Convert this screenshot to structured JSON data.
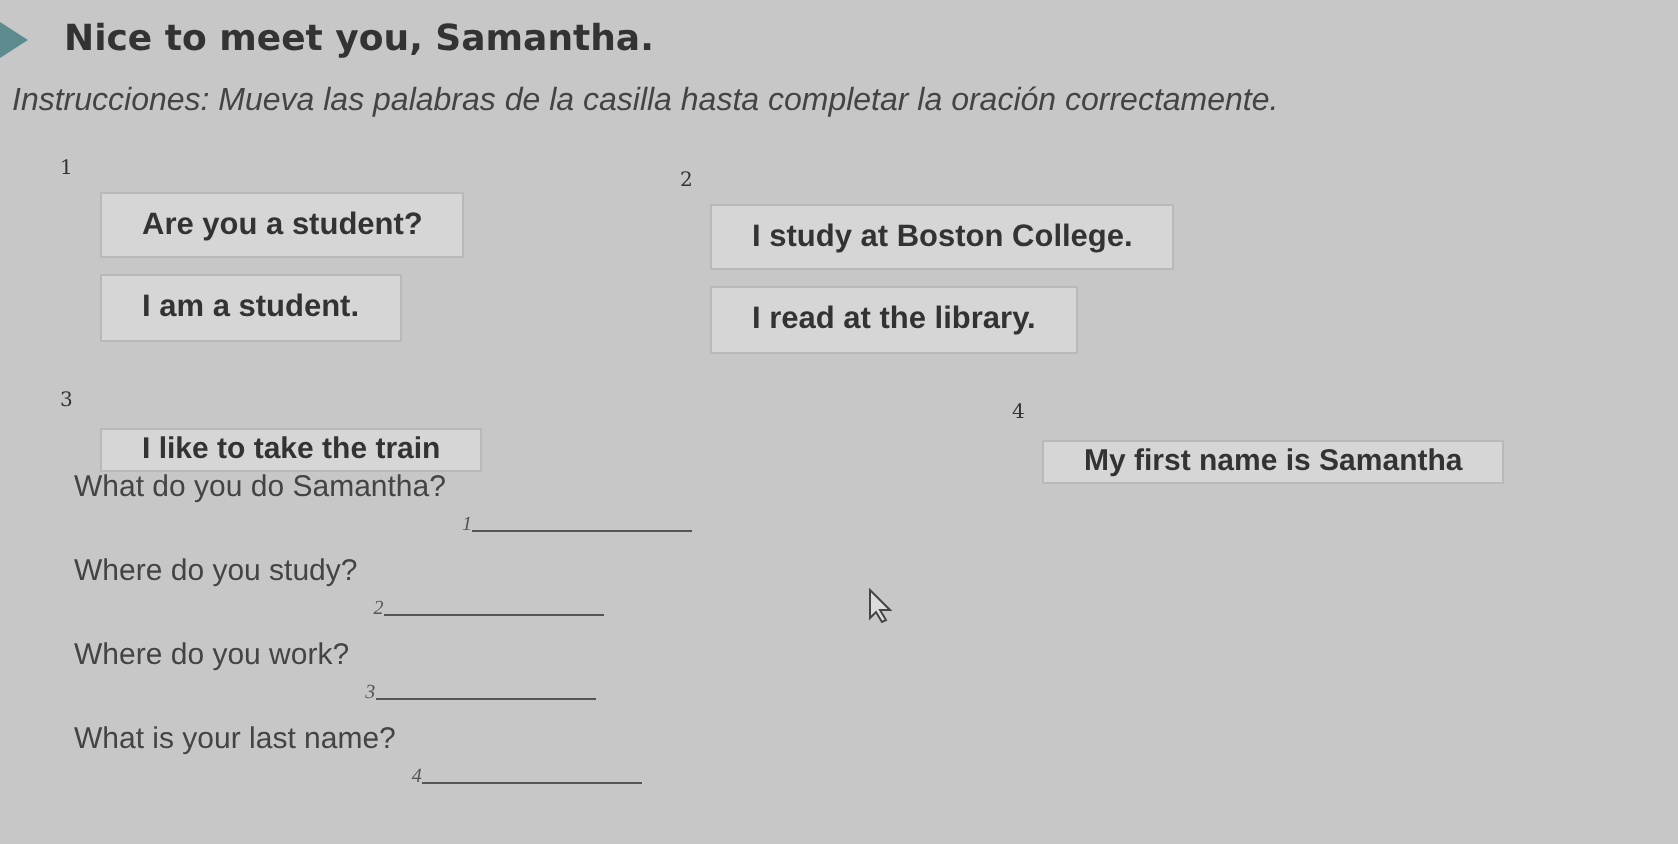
{
  "title": "Nice to meet you, Samantha.",
  "instructions": "Instrucciones: Mueva las palabras de la casilla hasta completar la oración correctamente.",
  "boxes": [
    {
      "number": "1",
      "cards": [
        "Are you a student?",
        "I am a student."
      ]
    },
    {
      "number": "2",
      "cards": [
        "I study at Boston College.",
        "I read at the library."
      ]
    },
    {
      "number": "3",
      "cards": [
        "I like to take the train"
      ]
    },
    {
      "number": "4",
      "cards": [
        "My first name is Samantha"
      ]
    }
  ],
  "questions": [
    {
      "text": "What do you do Samantha?",
      "blank": "1"
    },
    {
      "text": "Where do you study?",
      "blank": "2"
    },
    {
      "text": "Where do you work?",
      "blank": "3"
    },
    {
      "text": "What is your last name?",
      "blank": "4"
    }
  ]
}
